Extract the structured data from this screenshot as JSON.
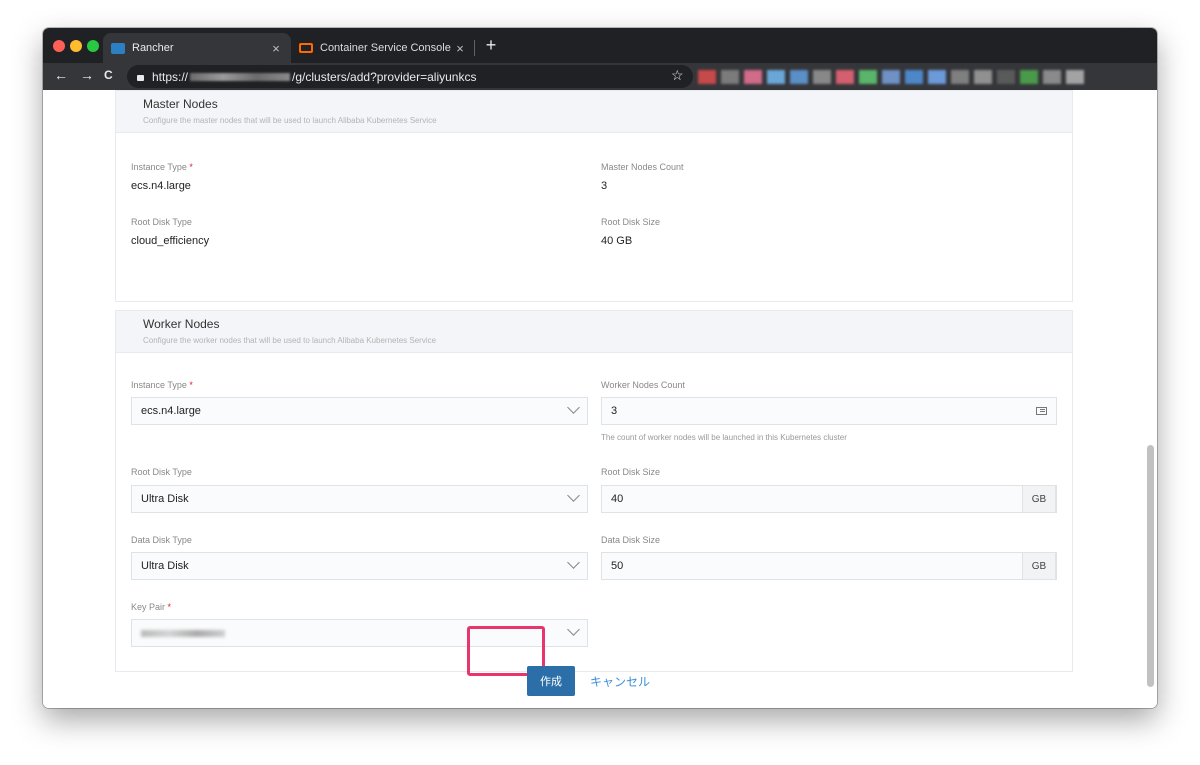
{
  "browser": {
    "tabs": [
      {
        "label": "Rancher",
        "close": "×",
        "favicon": "rancher-favicon"
      },
      {
        "label": "Container Service Console",
        "close": "×",
        "favicon": "alibaba-console-favicon"
      }
    ],
    "new_tab": "+",
    "nav": {
      "back": "←",
      "forward": "→",
      "reload": "C"
    },
    "url_prefix": "https://",
    "url_suffix": "/g/clusters/add?provider=aliyunkcs",
    "star": "☆"
  },
  "master": {
    "title": "Master Nodes",
    "desc": "Configure the master nodes that will be used to launch Alibaba Kubernetes Service",
    "instance_type_label": "Instance Type",
    "instance_type_value": "ecs.n4.large",
    "count_label": "Master Nodes Count",
    "count_value": "3",
    "root_disk_type_label": "Root Disk Type",
    "root_disk_type_value": "cloud_efficiency",
    "root_disk_size_label": "Root Disk Size",
    "root_disk_size_value": "40 GB"
  },
  "worker": {
    "title": "Worker Nodes",
    "desc": "Configure the worker nodes that will be used to launch Alibaba Kubernetes Service",
    "instance_type_label": "Instance Type",
    "instance_type_value": "ecs.n4.large",
    "count_label": "Worker Nodes Count",
    "count_value": "3",
    "count_help": "The count of worker nodes will be launched in this Kubernetes cluster",
    "root_disk_type_label": "Root Disk Type",
    "root_disk_type_value": "Ultra Disk",
    "root_disk_size_label": "Root Disk Size",
    "root_disk_size_value": "40",
    "root_disk_unit": "GB",
    "data_disk_type_label": "Data Disk Type",
    "data_disk_type_value": "Ultra Disk",
    "data_disk_size_label": "Data Disk Size",
    "data_disk_size_value": "50",
    "data_disk_unit": "GB",
    "key_pair_label": "Key Pair"
  },
  "required_mark": "*",
  "actions": {
    "create": "作成",
    "cancel": "キャンセル"
  },
  "colors": {
    "primary_button": "#2b6ea8",
    "highlight": "#e8356c",
    "link": "#3d8fd8",
    "required": "#e01d2f"
  }
}
